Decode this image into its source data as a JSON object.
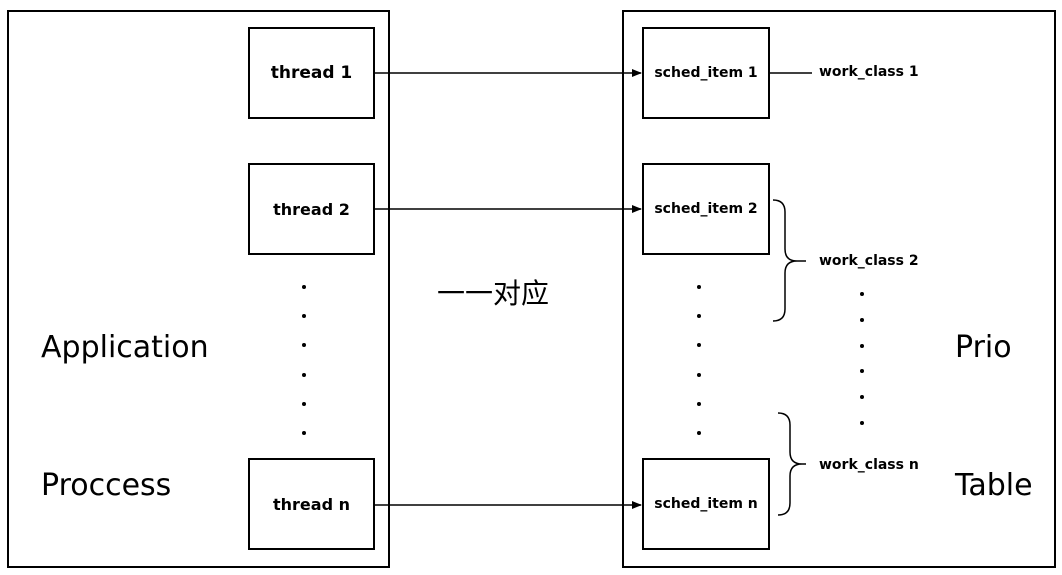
{
  "left_panel": {
    "title_line1": "Application",
    "title_line2": "Proccess",
    "threads": [
      "thread 1",
      "thread 2",
      "thread n"
    ]
  },
  "middle_label": "一一对应",
  "right_panel": {
    "title_line1": "Prio",
    "title_line2": "Table",
    "sched_items": [
      "sched_item 1",
      "sched_item 2",
      "sched_item n"
    ],
    "work_classes": [
      "work_class 1",
      "work_class 2",
      "work_class n"
    ]
  }
}
